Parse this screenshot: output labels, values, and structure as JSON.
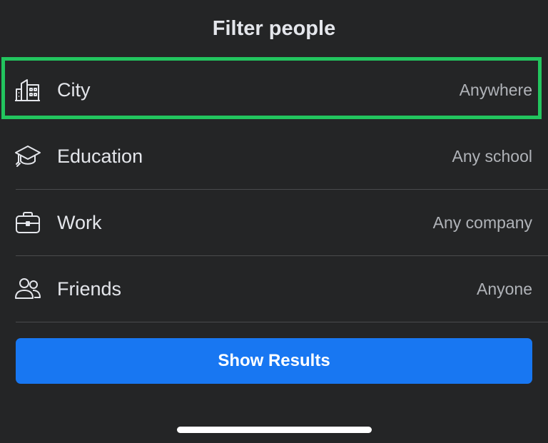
{
  "header": {
    "title": "Filter people"
  },
  "filters": [
    {
      "label": "City",
      "value": "Anywhere",
      "icon": "city-buildings-icon"
    },
    {
      "label": "Education",
      "value": "Any school",
      "icon": "graduation-cap-icon"
    },
    {
      "label": "Work",
      "value": "Any company",
      "icon": "briefcase-icon"
    },
    {
      "label": "Friends",
      "value": "Anyone",
      "icon": "people-icon"
    }
  ],
  "actions": {
    "show_results_label": "Show Results"
  },
  "colors": {
    "background": "#242526",
    "primary_button": "#1877f2",
    "highlight_border": "#22c55e",
    "text": "#e4e6eb",
    "secondary_text": "#b0b3b8"
  }
}
